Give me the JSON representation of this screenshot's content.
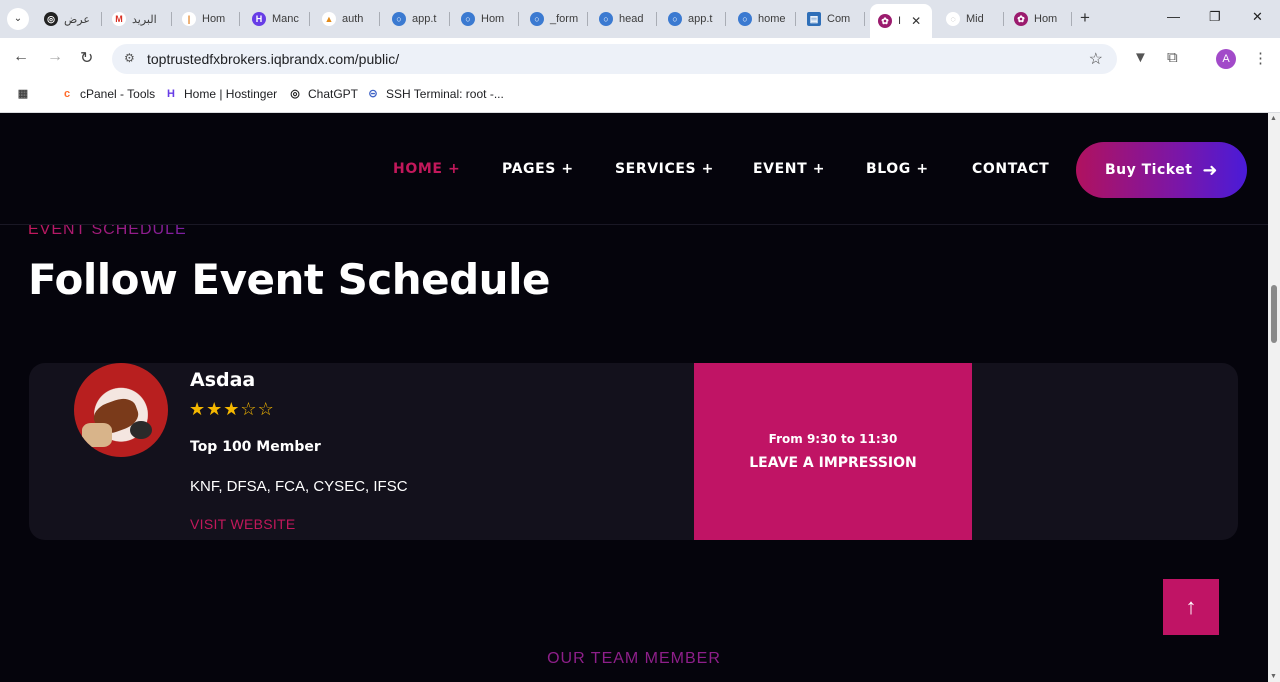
{
  "browser": {
    "tabs": [
      {
        "label": "عرض",
        "icon": "chatgpt-icon"
      },
      {
        "label": "البريد",
        "icon": "gmail-icon"
      },
      {
        "label": "Hom",
        "icon": "hostinger-icon"
      },
      {
        "label": "Manc",
        "icon": "hostinger-icon"
      },
      {
        "label": "auth",
        "icon": "aws-icon"
      },
      {
        "label": "app.t",
        "icon": "globe-icon"
      },
      {
        "label": "Hom",
        "icon": "globe-icon"
      },
      {
        "label": "_form",
        "icon": "globe-icon"
      },
      {
        "label": "head",
        "icon": "globe-icon"
      },
      {
        "label": "app.t",
        "icon": "globe-icon"
      },
      {
        "label": "home",
        "icon": "globe-icon"
      },
      {
        "label": "Com",
        "icon": "document-icon"
      },
      {
        "label": "I",
        "icon": "site-logo-icon",
        "active": true
      },
      {
        "label": "Mid",
        "icon": "loading-icon"
      },
      {
        "label": "Hom",
        "icon": "site-logo-icon"
      }
    ],
    "url": "toptrustedfxbrokers.iqbrandx.com/public/",
    "profile_initial": "A",
    "bookmarks": [
      {
        "label": "cPanel - Tools",
        "icon": "cpanel-icon"
      },
      {
        "label": "Home | Hostinger",
        "icon": "hostinger-icon"
      },
      {
        "label": "ChatGPT",
        "icon": "chatgpt-icon"
      },
      {
        "label": "SSH Terminal: root -...",
        "icon": "ssh-icon"
      }
    ]
  },
  "header": {
    "nav": [
      {
        "label": "HOME +",
        "active": true
      },
      {
        "label": "PAGES +"
      },
      {
        "label": "SERVICES +"
      },
      {
        "label": "EVENT +"
      },
      {
        "label": "BLOG +"
      },
      {
        "label": "CONTACT"
      }
    ],
    "cta_label": "Buy Ticket",
    "cta_icon": "arrow-right-icon"
  },
  "schedule": {
    "eyebrow": "EVENT SCHEDULE",
    "title": "Follow Event Schedule"
  },
  "event": {
    "name": "Asdaa",
    "rating": 3,
    "rating_max": 5,
    "membership": "Top 100 Member",
    "regulators": "KNF, DFSA, FCA, CYSEC, IFSC",
    "link_label": "VISIT WEBSITE",
    "time": "From 9:30 to 11:30",
    "action": "LEAVE A IMPRESSION"
  },
  "team": {
    "eyebrow": "OUR TEAM MEMBER"
  },
  "colors": {
    "accent": "#c01465",
    "background": "#05040c",
    "card": "#13111c",
    "star": "#f5b800"
  }
}
